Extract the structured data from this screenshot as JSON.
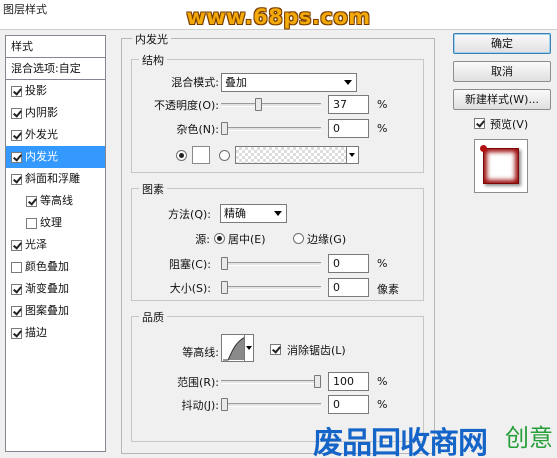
{
  "window": {
    "title": "图层样式"
  },
  "watermark": {
    "text": "www.68ps.com",
    "bottom_text": "废品回收商网",
    "bottom_corner": "创意"
  },
  "style_list": {
    "header": "样式",
    "blend_options": "混合选项:自定",
    "items": [
      {
        "label": "投影",
        "checked": true
      },
      {
        "label": "内阴影",
        "checked": true
      },
      {
        "label": "外发光",
        "checked": true
      },
      {
        "label": "内发光",
        "checked": true,
        "selected": true
      },
      {
        "label": "斜面和浮雕",
        "checked": true
      },
      {
        "label": "等高线",
        "checked": true,
        "sub": true
      },
      {
        "label": "纹理",
        "checked": false,
        "sub": true
      },
      {
        "label": "光泽",
        "checked": true
      },
      {
        "label": "颜色叠加",
        "checked": false
      },
      {
        "label": "渐变叠加",
        "checked": true
      },
      {
        "label": "图案叠加",
        "checked": true
      },
      {
        "label": "描边",
        "checked": true
      }
    ]
  },
  "panel": {
    "title": "内发光",
    "structure": {
      "title": "结构",
      "blend_mode_label": "混合模式:",
      "blend_mode_value": "叠加",
      "opacity_label": "不透明度(O):",
      "opacity_value": "37",
      "opacity_unit": "%",
      "noise_label": "杂色(N):",
      "noise_value": "0",
      "noise_unit": "%"
    },
    "elements": {
      "title": "图素",
      "method_label": "方法(Q):",
      "method_value": "精确",
      "source_label": "源:",
      "source_center": "居中(E)",
      "source_edge": "边缘(G)",
      "choke_label": "阻塞(C):",
      "choke_value": "0",
      "choke_unit": "%",
      "size_label": "大小(S):",
      "size_value": "0",
      "size_unit": "像素"
    },
    "quality": {
      "title": "品质",
      "contour_label": "等高线:",
      "antialias_label": "消除锯齿(L)",
      "range_label": "范围(R):",
      "range_value": "100",
      "range_unit": "%",
      "jitter_label": "抖动(J):",
      "jitter_value": "0",
      "jitter_unit": "%"
    }
  },
  "buttons": {
    "ok": "确定",
    "cancel": "取消",
    "new_style": "新建样式(W)...",
    "preview_label": "预览(V)"
  },
  "colors": {
    "selection": "#3399ff",
    "glow": "#9d0d0d"
  }
}
